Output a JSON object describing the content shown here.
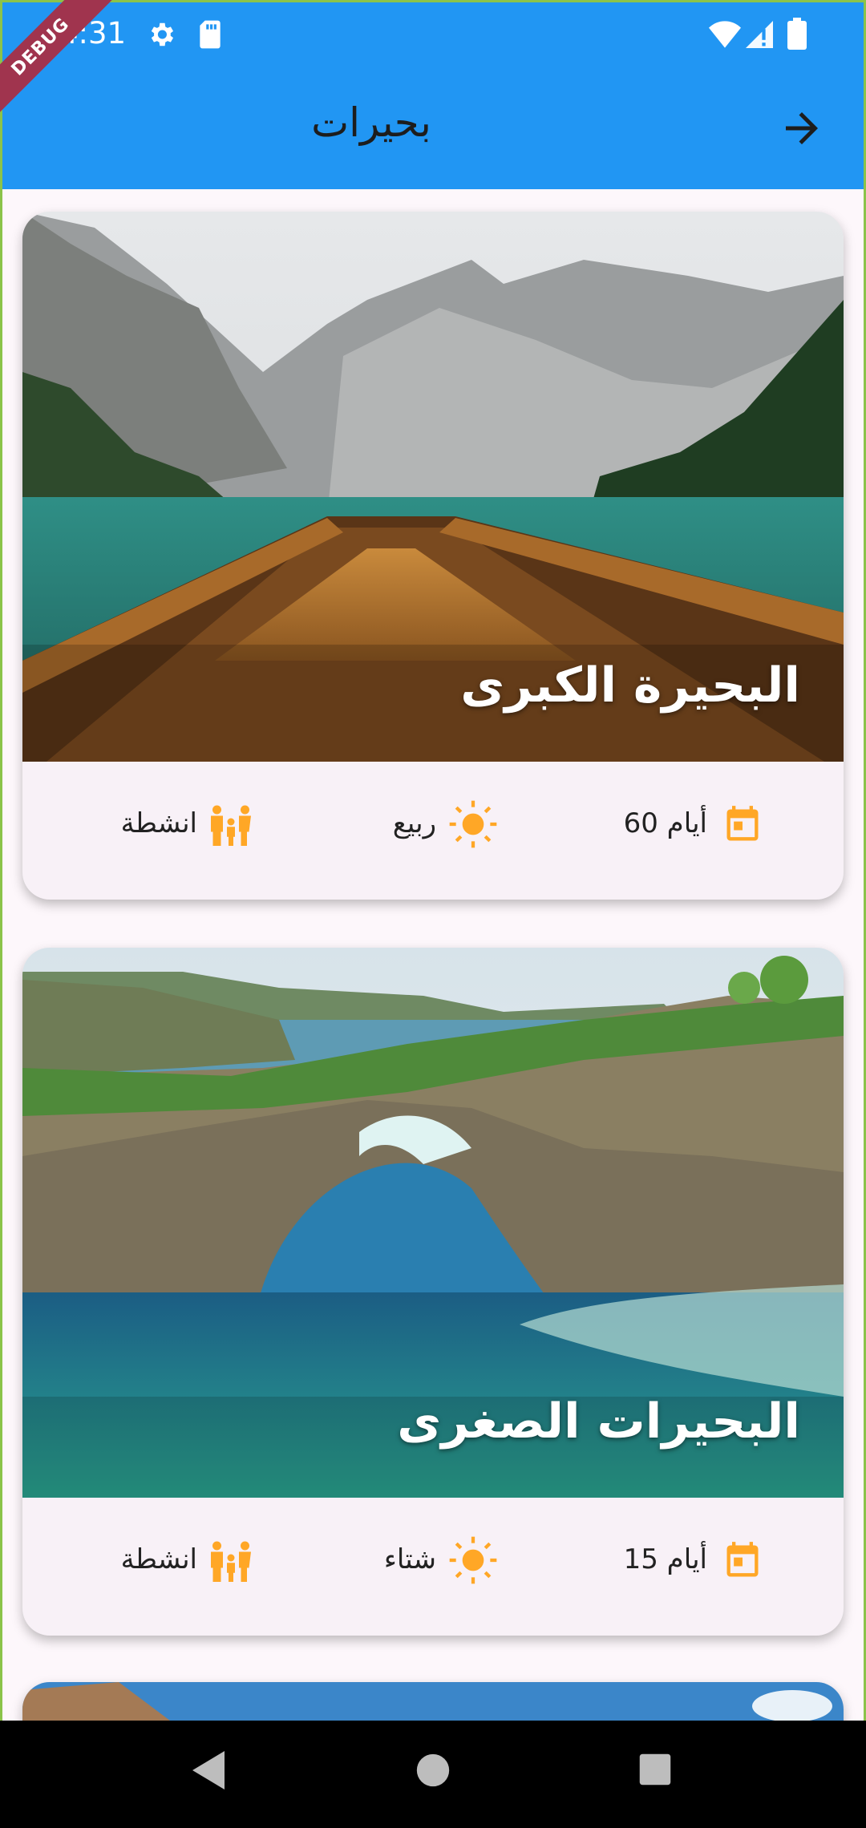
{
  "status_bar": {
    "time": "4:31"
  },
  "debug_banner": "DEBUG",
  "app_bar": {
    "title": "بحيرات"
  },
  "cards": [
    {
      "title": "البحيرة الكبرى",
      "duration": "60 أيام",
      "season": "ربيع",
      "activities": "انشطة"
    },
    {
      "title": "البحيرات الصغرى",
      "duration": "15 أيام",
      "season": "شتاء",
      "activities": "انشطة"
    }
  ],
  "colors": {
    "app_bar": "#2196f3",
    "accent_icon": "#ffa726",
    "card_bg": "#f8f1f7"
  }
}
